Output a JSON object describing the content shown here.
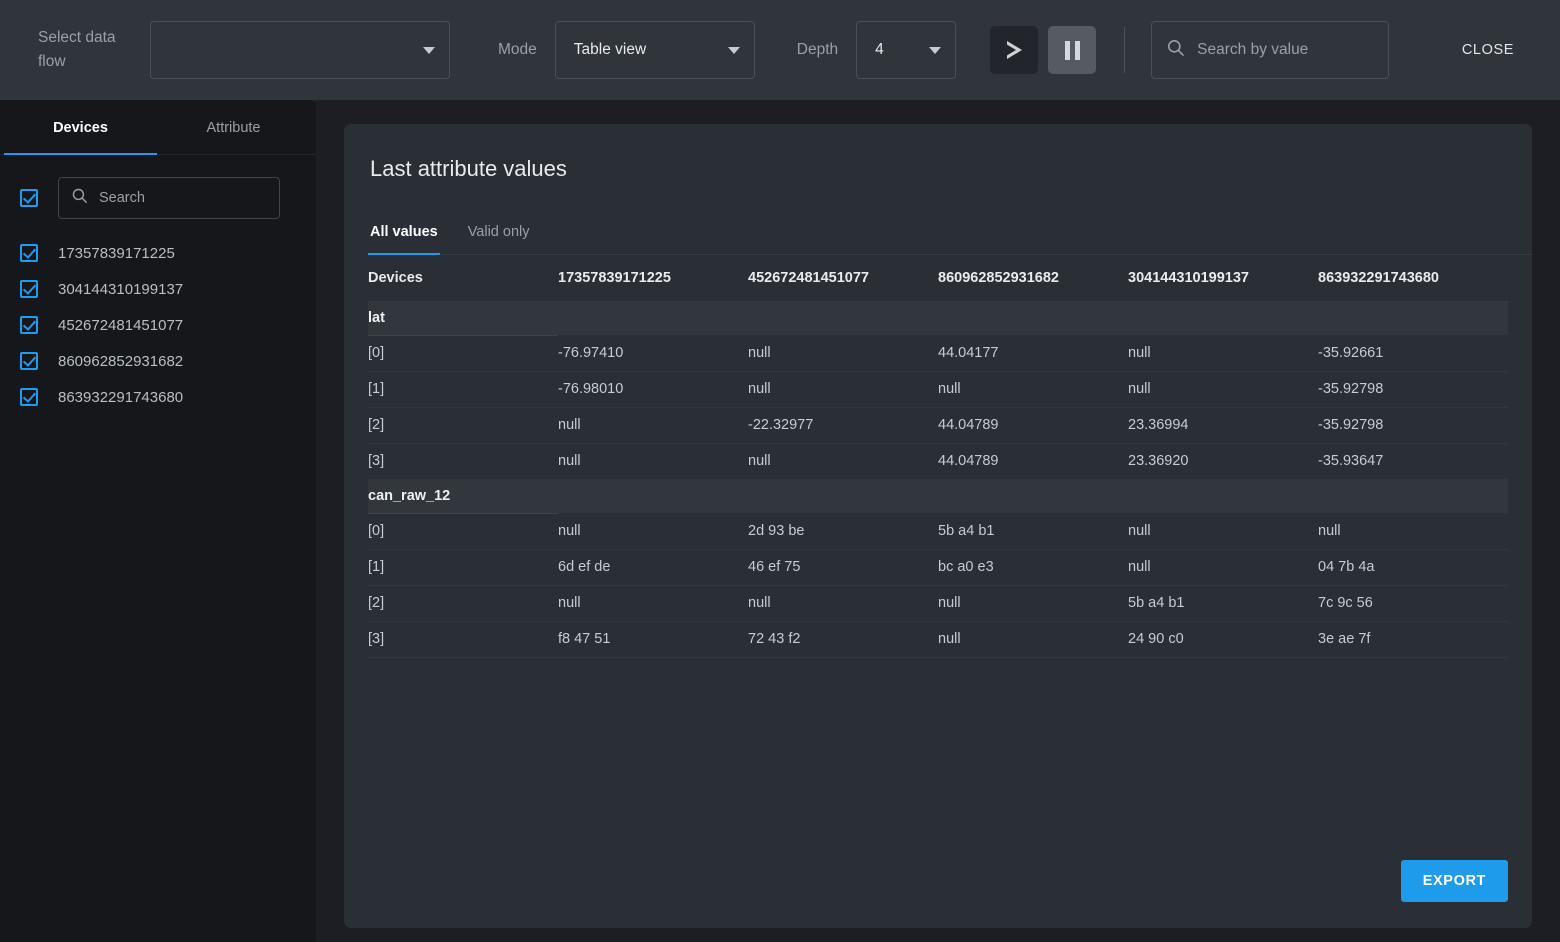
{
  "toolbar": {
    "dataflow_label": "Select data flow",
    "dataflow_value": "",
    "mode_label": "Mode",
    "mode_value": "Table view",
    "depth_label": "Depth",
    "depth_value": "4",
    "play_icon": "play-icon",
    "pause_icon": "pause-icon",
    "search_placeholder": "Search by value",
    "search_value": "",
    "search_icon": "search-icon",
    "close_label": "CLOSE"
  },
  "sidebar": {
    "tabs": [
      {
        "label": "Devices",
        "active": true
      },
      {
        "label": "Attribute",
        "active": false
      }
    ],
    "search_placeholder": "Search",
    "search_value": "",
    "select_all_checked": true,
    "devices": [
      {
        "name": "17357839171225",
        "checked": true
      },
      {
        "name": "304144310199137",
        "checked": true
      },
      {
        "name": "452672481451077",
        "checked": true
      },
      {
        "name": "860962852931682",
        "checked": true
      },
      {
        "name": "863932291743680",
        "checked": true
      }
    ]
  },
  "main": {
    "title": "Last attribute values",
    "tabs": [
      {
        "label": "All values",
        "active": true
      },
      {
        "label": "Valid only",
        "active": false
      }
    ],
    "export_label": "EXPORT",
    "table": {
      "columns": [
        "Devices",
        "17357839171225",
        "452672481451077",
        "860962852931682",
        "304144310199137",
        "863932291743680"
      ],
      "groups": [
        {
          "name": "lat",
          "rows": [
            {
              "index": "[0]",
              "values": [
                "-76.97410",
                "null",
                "44.04177",
                "null",
                "-35.92661"
              ]
            },
            {
              "index": "[1]",
              "values": [
                "-76.98010",
                "null",
                "null",
                "null",
                "-35.92798"
              ]
            },
            {
              "index": "[2]",
              "values": [
                "null",
                "-22.32977",
                "44.04789",
                "23.36994",
                "-35.92798"
              ]
            },
            {
              "index": "[3]",
              "values": [
                "null",
                "null",
                "44.04789",
                "23.36920",
                "-35.93647"
              ]
            }
          ]
        },
        {
          "name": "can_raw_12",
          "rows": [
            {
              "index": "[0]",
              "values": [
                "null",
                "2d 93 be",
                "5b a4 b1",
                "null",
                "null"
              ]
            },
            {
              "index": "[1]",
              "values": [
                "6d ef de",
                "46 ef 75",
                "bc a0 e3",
                "null",
                "04 7b 4a"
              ]
            },
            {
              "index": "[2]",
              "values": [
                "null",
                "null",
                "null",
                "5b a4 b1",
                "7c 9c 56"
              ]
            },
            {
              "index": "[3]",
              "values": [
                "f8 47 51",
                "72 43 f2",
                "null",
                "24 90 c0",
                "3e ae 7f"
              ]
            }
          ]
        }
      ]
    }
  },
  "colors": {
    "accent": "#1f9bef",
    "export": "#1e9bea",
    "toolbar_bg": "#30343b",
    "sidebar_bg": "#15171b",
    "card_bg": "#2a2e35",
    "page_bg": "#1c1e24"
  }
}
